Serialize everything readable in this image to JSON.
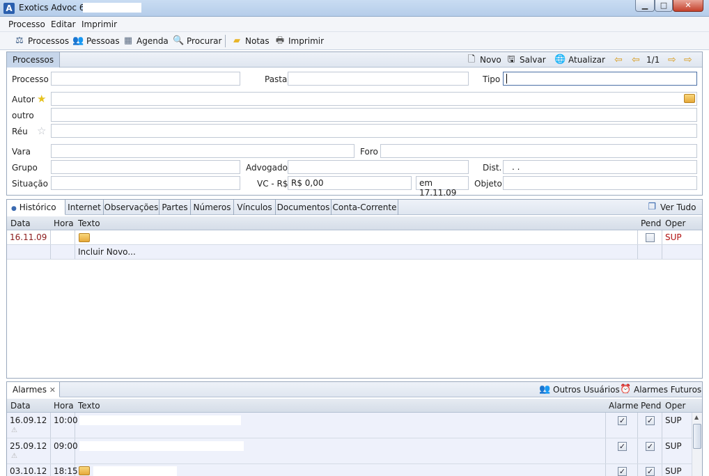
{
  "window": {
    "title": "Exotics Advoc 6 -",
    "app_icon_letter": "A",
    "btn_min": "▁",
    "btn_max": "□",
    "btn_close": "✕"
  },
  "menu": [
    "Processo",
    "Editar",
    "Imprimir"
  ],
  "toolbar": [
    {
      "label": "Processos",
      "icon": "scales-icon"
    },
    {
      "label": "Pessoas",
      "icon": "people-icon"
    },
    {
      "label": "Agenda",
      "icon": "calendar-icon"
    },
    {
      "label": "Procurar",
      "icon": "magnifier-icon"
    },
    {
      "label": "Notas",
      "icon": "note-icon"
    },
    {
      "label": "Imprimir",
      "icon": "printer-icon"
    }
  ],
  "processos_panel": {
    "tab": "Processos",
    "actions": {
      "novo": "Novo",
      "salvar": "Salvar",
      "atualizar": "Atualizar",
      "page": "1/1"
    },
    "labels": {
      "processo": "Processo",
      "pasta": "Pasta",
      "tipo": "Tipo",
      "autor": "Autor",
      "outro": "outro",
      "reu": "Réu",
      "vara": "Vara",
      "foro": "Foro",
      "grupo": "Grupo",
      "advogado": "Advogado",
      "dist": "Dist.",
      "situacao": "Situação",
      "vc": "VC - R$",
      "objeto": "Objeto"
    },
    "values": {
      "dist": ". .",
      "vc": "R$ 0,00",
      "em": "em 17.11.09"
    }
  },
  "historico_panel": {
    "tabs": [
      "Histórico",
      "Internet",
      "Observações",
      "Partes",
      "Números",
      "Vínculos",
      "Documentos",
      "Conta-Corrente"
    ],
    "ver_tudo": "Ver Tudo",
    "columns": {
      "data": "Data",
      "hora": "Hora",
      "texto": "Texto",
      "pend": "Pend",
      "oper": "Oper"
    },
    "rows": [
      {
        "data": "16.11.09",
        "hora": "",
        "oper": "SUP",
        "pend": false
      }
    ],
    "incluir_novo": "Incluir Novo..."
  },
  "alarmes_panel": {
    "tab": "Alarmes",
    "outros_usuarios": "Outros Usuários",
    "alarmes_futuros": "Alarmes Futuros",
    "columns": {
      "data": "Data",
      "hora": "Hora",
      "texto": "Texto",
      "alarme": "Alarme",
      "pend": "Pend",
      "oper": "Oper"
    },
    "rows": [
      {
        "data": "16.09.12",
        "hora": "10:00",
        "oper": "SUP",
        "alarme": true,
        "pend": true
      },
      {
        "data": "25.09.12",
        "hora": "09:00",
        "oper": "SUP",
        "alarme": true,
        "pend": true
      },
      {
        "data": "03.10.12",
        "hora": "18:15",
        "oper": "SUP",
        "alarme": true,
        "pend": true
      }
    ]
  },
  "colors": {
    "accent": "#2a5fae",
    "date_red": "#8b1a1a",
    "oper_red": "#b01010",
    "arrow": "#e0352b"
  }
}
